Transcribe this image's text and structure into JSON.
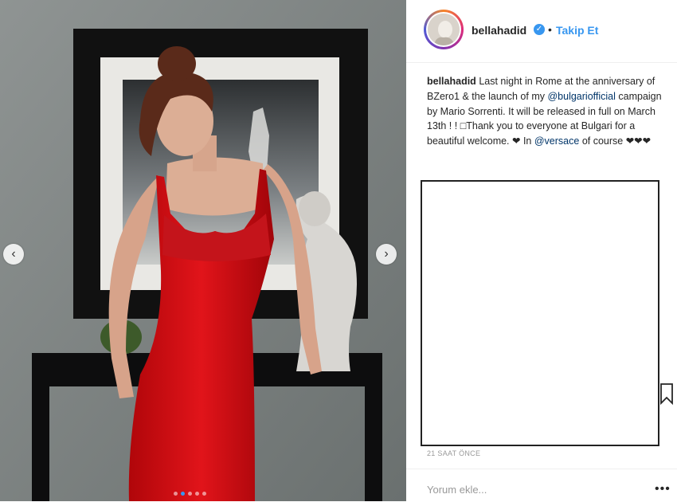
{
  "post": {
    "username": "bellahadid",
    "verified_icon": "verified-badge-icon",
    "separator": "•",
    "follow_label": "Takip Et",
    "caption": {
      "username": "bellahadid",
      "text_1": "Last night in Rome at the anniversary of BZero1 & the launch of my",
      "mention_1": "@bulgariofficial",
      "text_2": "campaign by Mario Sorrenti. It will be released in full on March 13th ! ! □Thank you to everyone at Bulgari for a beautiful welcome. ❤ In",
      "mention_2": "@versace",
      "text_3": "of course ❤❤❤"
    },
    "timestamp": "21 SAAT ÖNCE",
    "comment_placeholder": "Yorum ekle...",
    "more_label": "•••"
  },
  "carousel": {
    "prev_icon": "chevron-left-icon",
    "next_icon": "chevron-right-icon",
    "prev_glyph": "‹",
    "next_glyph": "›",
    "dot_count": 5,
    "active_dot": 1
  },
  "colors": {
    "accent": "#3897f0",
    "text": "#262626",
    "muted": "#999999"
  }
}
